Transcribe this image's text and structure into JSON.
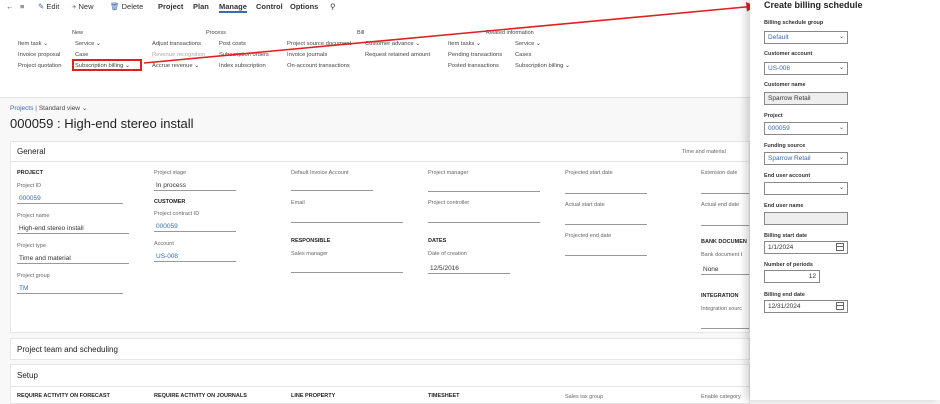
{
  "toolbar": {
    "edit": "Edit",
    "new": "New",
    "delete": "Delete",
    "menus": [
      "Project",
      "Plan",
      "Manage",
      "Control",
      "Options"
    ]
  },
  "ribbon": {
    "groups": {
      "new": "New",
      "process": "Process",
      "bill": "Bill",
      "related": "Related information"
    },
    "new_items": [
      "Item task",
      "Service",
      "Invoice proposal",
      "Case",
      "Project quotation",
      "Subscription billing"
    ],
    "process_items": [
      "Adjust transactions",
      "Post costs",
      "Revenue recognition",
      "Subscription orders",
      "Accrue revenue",
      "Index subscription"
    ],
    "bill_items": [
      "Project source document",
      "Customer advance",
      "Invoice journals",
      "Request retained amount",
      "On-account transactions"
    ],
    "related_items": [
      "Item tasks",
      "Service",
      "Pending transactions",
      "Cases",
      "Posted transactions",
      "Subscription billing"
    ]
  },
  "page": {
    "breadcrumb_link": "Projects",
    "breadcrumb_sep": "|",
    "view": "Standard view",
    "title": "000059 : High-end stereo install"
  },
  "general": {
    "header": "General",
    "header_right": "Time and material",
    "project_section": "PROJECT",
    "project_id_label": "Project ID",
    "project_id": "000059",
    "project_name_label": "Project name",
    "project_name": "High-end stereo install",
    "project_type_label": "Project type",
    "project_type": "Time and material",
    "project_group_label": "Project group",
    "project_group": "TM",
    "stage_label": "Project stage",
    "stage": "In process",
    "customer_section": "CUSTOMER",
    "contract_label": "Project contract ID",
    "contract": "000059",
    "account_label": "Account",
    "account": "US-008",
    "default_invoice_label": "Default Invoice Account",
    "email_label": "Email",
    "responsible_section": "RESPONSIBLE",
    "sales_manager_label": "Sales manager",
    "pm_label": "Project manager",
    "controller_label": "Project controller",
    "dates_section": "DATES",
    "creation_label": "Date of creation",
    "creation": "12/5/2016",
    "proj_start_label": "Projected start date",
    "actual_start_label": "Actual start date",
    "proj_end_label": "Projected end date",
    "ext_label": "Extension date",
    "actual_end_label": "Actual end date",
    "bank_section": "BANK DOCUMEN",
    "bank_doc_label": "Bank document t",
    "bank_doc": "None",
    "integration_section": "INTEGRATION",
    "integration_label": "Integration sourc"
  },
  "team": {
    "header": "Project team and scheduling"
  },
  "setup": {
    "header": "Setup",
    "cols": [
      "REQUIRE ACTIVITY ON FORECAST",
      "REQUIRE ACTIVITY ON JOURNALS",
      "LINE PROPERTY",
      "TIMESHEET",
      "Sales tax group",
      "Enable category"
    ]
  },
  "panel": {
    "title": "Create billing schedule",
    "group_label": "Billing schedule group",
    "group": "Default",
    "cust_label": "Customer account",
    "cust": "US-008",
    "cust_name_label": "Customer name",
    "cust_name": "Sparrow Retail",
    "project_label": "Project",
    "project": "000059",
    "funding_label": "Funding source",
    "funding": "Sparrow Retail",
    "end_acct_label": "End user account",
    "end_acct": "",
    "end_name_label": "End user name",
    "end_name": "",
    "start_label": "Billing start date",
    "start": "1/1/2024",
    "periods_label": "Number of periods",
    "periods": "12",
    "end_label": "Billing end date",
    "end": "12/31/2024"
  },
  "colors": {
    "accent": "#3a6ab0",
    "callout": "#e02020"
  }
}
